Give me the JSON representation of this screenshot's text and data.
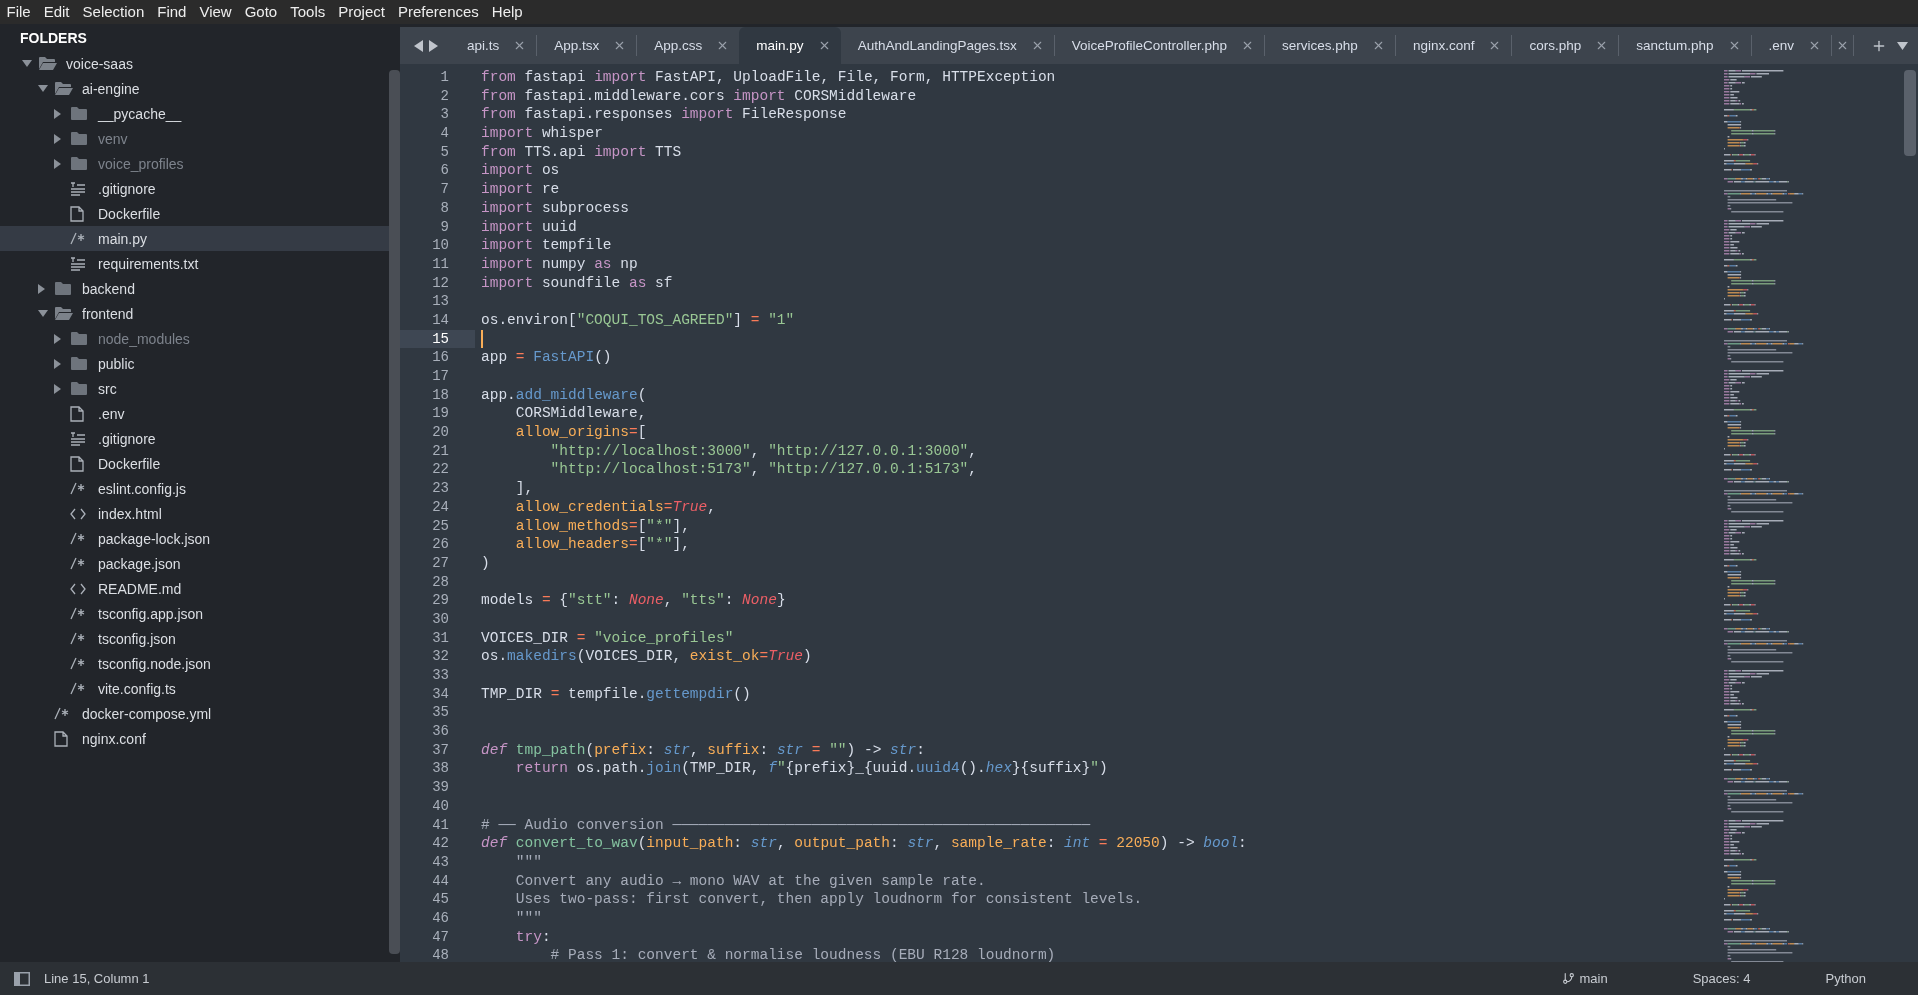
{
  "menu": [
    "File",
    "Edit",
    "Selection",
    "Find",
    "View",
    "Goto",
    "Tools",
    "Project",
    "Preferences",
    "Help"
  ],
  "sidebar": {
    "title": "FOLDERS",
    "tree": [
      {
        "label": "voice-saas",
        "kind": "folder",
        "expanded": true,
        "ignored": false,
        "selected": false,
        "children": [
          {
            "label": "ai-engine",
            "kind": "folder",
            "expanded": true,
            "ignored": false,
            "selected": false,
            "children": [
              {
                "label": "__pycache__",
                "kind": "folder",
                "expanded": false,
                "ignored": false,
                "selected": false
              },
              {
                "label": "venv",
                "kind": "folder",
                "expanded": false,
                "ignored": true,
                "selected": false
              },
              {
                "label": "voice_profiles",
                "kind": "folder",
                "expanded": false,
                "ignored": true,
                "selected": false
              },
              {
                "label": ".gitignore",
                "kind": "lines",
                "selected": false
              },
              {
                "label": "Dockerfile",
                "kind": "file",
                "selected": false
              },
              {
                "label": "main.py",
                "kind": "code",
                "selected": true
              },
              {
                "label": "requirements.txt",
                "kind": "lines",
                "selected": false
              }
            ]
          },
          {
            "label": "backend",
            "kind": "folder",
            "expanded": false,
            "ignored": false,
            "selected": false
          },
          {
            "label": "frontend",
            "kind": "folder",
            "expanded": true,
            "ignored": false,
            "selected": false,
            "children": [
              {
                "label": "node_modules",
                "kind": "folder",
                "expanded": false,
                "ignored": true,
                "selected": false
              },
              {
                "label": "public",
                "kind": "folder",
                "expanded": false,
                "ignored": false,
                "selected": false
              },
              {
                "label": "src",
                "kind": "folder",
                "expanded": false,
                "ignored": false,
                "selected": false
              },
              {
                "label": ".env",
                "kind": "file",
                "selected": false
              },
              {
                "label": ".gitignore",
                "kind": "lines",
                "selected": false
              },
              {
                "label": "Dockerfile",
                "kind": "file",
                "selected": false
              },
              {
                "label": "eslint.config.js",
                "kind": "code",
                "selected": false
              },
              {
                "label": "index.html",
                "kind": "markup",
                "selected": false
              },
              {
                "label": "package-lock.json",
                "kind": "code",
                "selected": false
              },
              {
                "label": "package.json",
                "kind": "code",
                "selected": false
              },
              {
                "label": "README.md",
                "kind": "markup",
                "selected": false
              },
              {
                "label": "tsconfig.app.json",
                "kind": "code",
                "selected": false
              },
              {
                "label": "tsconfig.json",
                "kind": "code",
                "selected": false
              },
              {
                "label": "tsconfig.node.json",
                "kind": "code",
                "selected": false
              },
              {
                "label": "vite.config.ts",
                "kind": "code",
                "selected": false
              }
            ]
          },
          {
            "label": "docker-compose.yml",
            "kind": "code",
            "selected": false
          },
          {
            "label": "nginx.conf",
            "kind": "file",
            "selected": false
          }
        ]
      }
    ]
  },
  "tabs": [
    {
      "label": "api.ts",
      "selected": false
    },
    {
      "label": "App.tsx",
      "selected": false
    },
    {
      "label": "App.css",
      "selected": false
    },
    {
      "label": "main.py",
      "selected": true
    },
    {
      "label": "AuthAndLandingPages.tsx",
      "selected": false
    },
    {
      "label": "VoiceProfileController.php",
      "selected": false
    },
    {
      "label": "services.php",
      "selected": false
    },
    {
      "label": "nginx.conf",
      "selected": false
    },
    {
      "label": "cors.php",
      "selected": false
    },
    {
      "label": "sanctum.php",
      "selected": false
    },
    {
      "label": ".env",
      "selected": false
    }
  ],
  "code": {
    "lines": [
      {
        "n": "1",
        "current": false,
        "tokens": [
          {
            "text": "from",
            "kind": "kw"
          },
          {
            "text": " fastapi ",
            "kind": "t"
          },
          {
            "text": "import",
            "kind": "kw"
          },
          {
            "text": " FastAPI, UploadFile, File, Form, HTTPException",
            "kind": "t"
          }
        ]
      },
      {
        "n": "2",
        "current": false,
        "tokens": [
          {
            "text": "from",
            "kind": "kw"
          },
          {
            "text": " fastapi.middleware.cors ",
            "kind": "t"
          },
          {
            "text": "import",
            "kind": "kw"
          },
          {
            "text": " CORSMiddleware",
            "kind": "t"
          }
        ]
      },
      {
        "n": "3",
        "current": false,
        "tokens": [
          {
            "text": "from",
            "kind": "kw"
          },
          {
            "text": " fastapi.responses ",
            "kind": "t"
          },
          {
            "text": "import",
            "kind": "kw"
          },
          {
            "text": " FileResponse",
            "kind": "t"
          }
        ]
      },
      {
        "n": "4",
        "current": false,
        "tokens": [
          {
            "text": "import",
            "kind": "kw"
          },
          {
            "text": " whisper",
            "kind": "t"
          }
        ]
      },
      {
        "n": "5",
        "current": false,
        "tokens": [
          {
            "text": "from",
            "kind": "kw"
          },
          {
            "text": " TTS.api ",
            "kind": "t"
          },
          {
            "text": "import",
            "kind": "kw"
          },
          {
            "text": " TTS",
            "kind": "t"
          }
        ]
      },
      {
        "n": "6",
        "current": false,
        "tokens": [
          {
            "text": "import",
            "kind": "kw"
          },
          {
            "text": " os",
            "kind": "t"
          }
        ]
      },
      {
        "n": "7",
        "current": false,
        "tokens": [
          {
            "text": "import",
            "kind": "kw"
          },
          {
            "text": " re",
            "kind": "t"
          }
        ]
      },
      {
        "n": "8",
        "current": false,
        "tokens": [
          {
            "text": "import",
            "kind": "kw"
          },
          {
            "text": " subprocess",
            "kind": "t"
          }
        ]
      },
      {
        "n": "9",
        "current": false,
        "tokens": [
          {
            "text": "import",
            "kind": "kw"
          },
          {
            "text": " uuid",
            "kind": "t"
          }
        ]
      },
      {
        "n": "10",
        "current": false,
        "tokens": [
          {
            "text": "import",
            "kind": "kw"
          },
          {
            "text": " tempfile",
            "kind": "t"
          }
        ]
      },
      {
        "n": "11",
        "current": false,
        "tokens": [
          {
            "text": "import",
            "kind": "kw"
          },
          {
            "text": " numpy ",
            "kind": "t"
          },
          {
            "text": "as",
            "kind": "kw"
          },
          {
            "text": " np",
            "kind": "t"
          }
        ]
      },
      {
        "n": "12",
        "current": false,
        "tokens": [
          {
            "text": "import",
            "kind": "kw"
          },
          {
            "text": " soundfile ",
            "kind": "t"
          },
          {
            "text": "as",
            "kind": "kw"
          },
          {
            "text": " sf",
            "kind": "t"
          }
        ]
      },
      {
        "n": "13",
        "current": false
      },
      {
        "n": "14",
        "current": false,
        "tokens": [
          {
            "text": "os.environ[",
            "kind": "t"
          },
          {
            "text": "\"COQUI_TOS_AGREED\"",
            "kind": "s"
          },
          {
            "text": "] ",
            "kind": "t"
          },
          {
            "text": "= ",
            "kind": "o"
          },
          {
            "text": "\"1\"",
            "kind": "s"
          }
        ]
      },
      {
        "n": "15",
        "current": true
      },
      {
        "n": "16",
        "current": false,
        "tokens": [
          {
            "text": "app ",
            "kind": "t"
          },
          {
            "text": "= ",
            "kind": "o"
          },
          {
            "text": "FastAPI",
            "kind": "f"
          },
          {
            "text": "()",
            "kind": "t"
          }
        ]
      },
      {
        "n": "17",
        "current": false
      },
      {
        "n": "18",
        "current": false,
        "tokens": [
          {
            "text": "app.",
            "kind": "t"
          },
          {
            "text": "add_middleware",
            "kind": "f"
          },
          {
            "text": "(",
            "kind": "t"
          }
        ]
      },
      {
        "n": "19",
        "current": false,
        "tokens": [
          {
            "text": "    CORSMiddleware,",
            "kind": "t"
          }
        ]
      },
      {
        "n": "20",
        "current": false,
        "tokens": [
          {
            "text": "    allow_origins",
            "kind": "p"
          },
          {
            "text": "=",
            "kind": "o"
          },
          {
            "text": "[",
            "kind": "t"
          }
        ]
      },
      {
        "n": "21",
        "current": false,
        "tokens": [
          {
            "text": "        \"http://localhost:3000\"",
            "kind": "s"
          },
          {
            "text": ", ",
            "kind": "t"
          },
          {
            "text": "\"http://127.0.0.1:3000\"",
            "kind": "s"
          },
          {
            "text": ",",
            "kind": "t"
          }
        ]
      },
      {
        "n": "22",
        "current": false,
        "tokens": [
          {
            "text": "        \"http://localhost:5173\"",
            "kind": "s"
          },
          {
            "text": ", ",
            "kind": "t"
          },
          {
            "text": "\"http://127.0.0.1:5173\"",
            "kind": "s"
          },
          {
            "text": ",",
            "kind": "t"
          }
        ]
      },
      {
        "n": "23",
        "current": false,
        "tokens": [
          {
            "text": "    ],",
            "kind": "t"
          }
        ]
      },
      {
        "n": "24",
        "current": false,
        "tokens": [
          {
            "text": "    allow_credentials",
            "kind": "p"
          },
          {
            "text": "=",
            "kind": "o"
          },
          {
            "text": "True",
            "kind": "c"
          },
          {
            "text": ",",
            "kind": "t"
          }
        ]
      },
      {
        "n": "25",
        "current": false,
        "tokens": [
          {
            "text": "    allow_methods",
            "kind": "p"
          },
          {
            "text": "=",
            "kind": "o"
          },
          {
            "text": "[",
            "kind": "t"
          },
          {
            "text": "\"*\"",
            "kind": "s"
          },
          {
            "text": "],",
            "kind": "t"
          }
        ]
      },
      {
        "n": "26",
        "current": false,
        "tokens": [
          {
            "text": "    allow_headers",
            "kind": "p"
          },
          {
            "text": "=",
            "kind": "o"
          },
          {
            "text": "[",
            "kind": "t"
          },
          {
            "text": "\"*\"",
            "kind": "s"
          },
          {
            "text": "],",
            "kind": "t"
          }
        ]
      },
      {
        "n": "27",
        "current": false,
        "tokens": [
          {
            "text": ")",
            "kind": "t"
          }
        ]
      },
      {
        "n": "28",
        "current": false
      },
      {
        "n": "29",
        "current": false,
        "tokens": [
          {
            "text": "models ",
            "kind": "t"
          },
          {
            "text": "=",
            "kind": "o"
          },
          {
            "text": " {",
            "kind": "t"
          },
          {
            "text": "\"stt\"",
            "kind": "s"
          },
          {
            "text": ": ",
            "kind": "t"
          },
          {
            "text": "None",
            "kind": "c"
          },
          {
            "text": ", ",
            "kind": "t"
          },
          {
            "text": "\"tts\"",
            "kind": "s"
          },
          {
            "text": ": ",
            "kind": "t"
          },
          {
            "text": "None",
            "kind": "c"
          },
          {
            "text": "}",
            "kind": "t"
          }
        ]
      },
      {
        "n": "30",
        "current": false
      },
      {
        "n": "31",
        "current": false,
        "tokens": [
          {
            "text": "VOICES_DIR ",
            "kind": "t"
          },
          {
            "text": "= ",
            "kind": "o"
          },
          {
            "text": "\"voice_profiles\"",
            "kind": "s"
          }
        ]
      },
      {
        "n": "32",
        "current": false,
        "tokens": [
          {
            "text": "os.",
            "kind": "t"
          },
          {
            "text": "makedirs",
            "kind": "f"
          },
          {
            "text": "(VOICES_DIR, ",
            "kind": "t"
          },
          {
            "text": "exist_ok",
            "kind": "p"
          },
          {
            "text": "=",
            "kind": "o"
          },
          {
            "text": "True",
            "kind": "c"
          },
          {
            "text": ")",
            "kind": "t"
          }
        ]
      },
      {
        "n": "33",
        "current": false
      },
      {
        "n": "34",
        "current": false,
        "tokens": [
          {
            "text": "TMP_DIR ",
            "kind": "t"
          },
          {
            "text": "=",
            "kind": "o"
          },
          {
            "text": " tempfile.",
            "kind": "t"
          },
          {
            "text": "gettempdir",
            "kind": "f"
          },
          {
            "text": "()",
            "kind": "t"
          }
        ]
      },
      {
        "n": "35",
        "current": false
      },
      {
        "n": "36",
        "current": false
      },
      {
        "n": "37",
        "current": false,
        "tokens": [
          {
            "text": "def ",
            "kind": "d"
          },
          {
            "text": "tmp_path",
            "kind": "fd"
          },
          {
            "text": "(",
            "kind": "t"
          },
          {
            "text": "prefix",
            "kind": "p"
          },
          {
            "text": ": ",
            "kind": "t"
          },
          {
            "text": "str",
            "kind": "ty"
          },
          {
            "text": ", ",
            "kind": "t"
          },
          {
            "text": "suffix",
            "kind": "p"
          },
          {
            "text": ": ",
            "kind": "t"
          },
          {
            "text": "str",
            "kind": "ty"
          },
          {
            "text": " = ",
            "kind": "o"
          },
          {
            "text": "\"\"",
            "kind": "s"
          },
          {
            "text": ") -> ",
            "kind": "t"
          },
          {
            "text": "str",
            "kind": "ty"
          },
          {
            "text": ":",
            "kind": "t"
          }
        ]
      },
      {
        "n": "38",
        "current": false,
        "tokens": [
          {
            "text": "    return",
            "kind": "kw"
          },
          {
            "text": " os.path.",
            "kind": "t"
          },
          {
            "text": "join",
            "kind": "f"
          },
          {
            "text": "(TMP_DIR, ",
            "kind": "t"
          },
          {
            "text": "f",
            "kind": "ty"
          },
          {
            "text": "\"",
            "kind": "s"
          },
          {
            "text": "{prefix}_{uuid.",
            "kind": "t"
          },
          {
            "text": "uuid4",
            "kind": "f"
          },
          {
            "text": "().",
            "kind": "t"
          },
          {
            "text": "hex",
            "kind": "ty"
          },
          {
            "text": "}{suffix}",
            "kind": "t"
          },
          {
            "text": "\"",
            "kind": "s"
          },
          {
            "text": ")",
            "kind": "t"
          }
        ]
      },
      {
        "n": "39",
        "current": false
      },
      {
        "n": "40",
        "current": false
      },
      {
        "n": "41",
        "current": false,
        "tokens": [
          {
            "text": "# ── Audio conversion ────────────────────────────────────────────────",
            "kind": "cm"
          }
        ]
      },
      {
        "n": "42",
        "current": false,
        "tokens": [
          {
            "text": "def ",
            "kind": "d"
          },
          {
            "text": "convert_to_wav",
            "kind": "fd"
          },
          {
            "text": "(",
            "kind": "t"
          },
          {
            "text": "input_path",
            "kind": "p"
          },
          {
            "text": ": ",
            "kind": "t"
          },
          {
            "text": "str",
            "kind": "ty"
          },
          {
            "text": ", ",
            "kind": "t"
          },
          {
            "text": "output_path",
            "kind": "p"
          },
          {
            "text": ": ",
            "kind": "t"
          },
          {
            "text": "str",
            "kind": "ty"
          },
          {
            "text": ", ",
            "kind": "t"
          },
          {
            "text": "sample_rate",
            "kind": "p"
          },
          {
            "text": ": ",
            "kind": "t"
          },
          {
            "text": "int",
            "kind": "ty"
          },
          {
            "text": " = ",
            "kind": "o"
          },
          {
            "text": "22050",
            "kind": "num"
          },
          {
            "text": ") -> ",
            "kind": "t"
          },
          {
            "text": "bool",
            "kind": "ty"
          },
          {
            "text": ":",
            "kind": "t"
          }
        ]
      },
      {
        "n": "43",
        "current": false,
        "tokens": [
          {
            "text": "    \"\"\"",
            "kind": "cm"
          }
        ]
      },
      {
        "n": "44",
        "current": false,
        "tokens": [
          {
            "text": "    Convert any audio → mono WAV at the given sample rate.",
            "kind": "cm"
          }
        ]
      },
      {
        "n": "45",
        "current": false,
        "tokens": [
          {
            "text": "    Uses two-pass: first convert, then apply loudnorm for consistent levels.",
            "kind": "cm"
          }
        ]
      },
      {
        "n": "46",
        "current": false,
        "tokens": [
          {
            "text": "    \"\"\"",
            "kind": "cm"
          }
        ]
      },
      {
        "n": "47",
        "current": false,
        "tokens": [
          {
            "text": "    try",
            "kind": "kw"
          },
          {
            "text": ":",
            "kind": "t"
          }
        ]
      },
      {
        "n": "48",
        "current": false,
        "tokens": [
          {
            "text": "        # Pass 1: convert & normalise loudness (EBU R128 loudnorm)",
            "kind": "cm"
          }
        ]
      }
    ]
  },
  "status_bar": {
    "position": "Line 15, Column 1",
    "branch": "main",
    "indent": "Spaces: 4",
    "syntax": "Python"
  }
}
